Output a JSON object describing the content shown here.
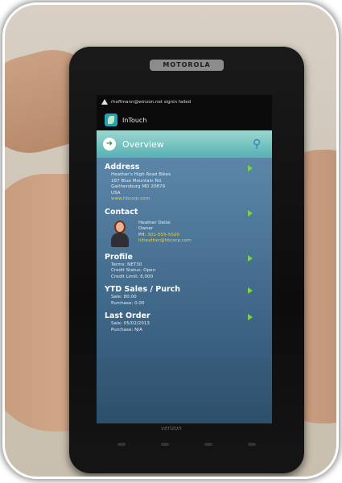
{
  "phone": {
    "brand": "MOTOROLA",
    "carrier": "verizon"
  },
  "status_bar": {
    "notification": "rhoffmann@winzon.net signin failed"
  },
  "app": {
    "name": "InTouch"
  },
  "header": {
    "title": "Overview",
    "search_icon": "search-icon",
    "nav_icon": "forward-arrow-icon"
  },
  "sections": {
    "address": {
      "title": "Address",
      "lines": [
        "Heather's High Road Bikes",
        "187 Blue Mountain Rd.",
        "Gaithersburg MD 20879",
        "USA"
      ],
      "link": "www.hbcorp.com"
    },
    "contact": {
      "title": "Contact",
      "name": "Heather Delisl",
      "role": "Owner",
      "phone_label": "PH:",
      "phone": "301-555-5020",
      "email": "hiheather@hbcorp.com"
    },
    "profile": {
      "title": "Profile",
      "lines": [
        "Terms: NET30",
        "Credit Status: Open",
        "Credit Limit: 8,000"
      ]
    },
    "ytd": {
      "title": "YTD Sales / Purch",
      "lines": [
        "Sale: 80.00",
        "Purchase: 0.00"
      ]
    },
    "last_order": {
      "title": "Last Order",
      "lines": [
        "Sale: 05/02/2013",
        "Purchase: N/A"
      ]
    }
  },
  "colors": {
    "accent": "#57b0b4",
    "arrow": "#7ad33f",
    "link": "#f1d22e",
    "panel": "#3f6788"
  }
}
